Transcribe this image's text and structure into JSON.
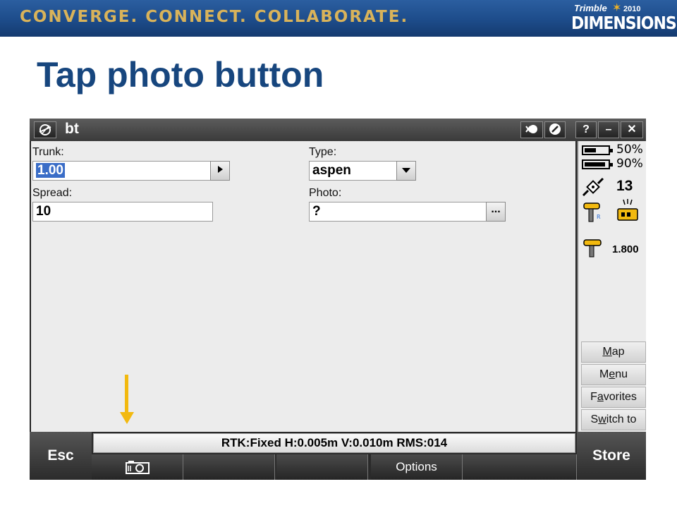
{
  "banner": {
    "tagline": "CONVERGE. CONNECT. COLLABORATE.",
    "brand_company": "Trimble",
    "brand_year": "2010",
    "brand_event": "DIMENSIONS"
  },
  "slide_title": "Tap photo button",
  "window": {
    "title": "bt",
    "help_label": "?",
    "minimize_label": "–",
    "close_label": "✕"
  },
  "form": {
    "trunk_label": "Trunk:",
    "trunk_value": "1.00",
    "type_label": "Type:",
    "type_value": "aspen",
    "spread_label": "Spread:",
    "spread_value": "10",
    "photo_label": "Photo:",
    "photo_value": "?",
    "browse_label": "..."
  },
  "status_panel": {
    "battery1_percent": "50%",
    "battery2_percent": "90%",
    "satellites": "13",
    "antenna_height": "1.800",
    "battery1_level": 0.5,
    "battery2_level": 0.9
  },
  "side_buttons": [
    {
      "pre": "",
      "key": "M",
      "post": "ap"
    },
    {
      "pre": "M",
      "key": "e",
      "post": "nu"
    },
    {
      "pre": "F",
      "key": "a",
      "post": "vorites"
    },
    {
      "pre": "S",
      "key": "w",
      "post": "itch to"
    }
  ],
  "bottom": {
    "esc_label": "Esc",
    "store_label": "Store",
    "status_line": "RTK:Fixed H:0.005m V:0.010m RMS:014",
    "options_label": "Options"
  },
  "colors": {
    "banner_blue": "#1d4c8a",
    "title_blue": "#17467e",
    "arrow_yellow": "#f2b90f",
    "selection_blue": "#3a6dc7"
  }
}
